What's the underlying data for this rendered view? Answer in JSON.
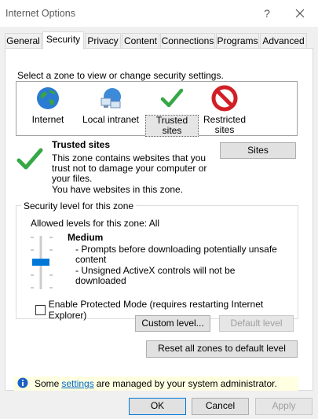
{
  "window": {
    "title": "Internet Options"
  },
  "title_buttons": {
    "help": "?",
    "close": "✕"
  },
  "tabs": [
    {
      "label": "General",
      "active": false
    },
    {
      "label": "Security",
      "active": true
    },
    {
      "label": "Privacy",
      "active": false
    },
    {
      "label": "Content",
      "active": false
    },
    {
      "label": "Connections",
      "active": false
    },
    {
      "label": "Programs",
      "active": false
    },
    {
      "label": "Advanced",
      "active": false
    }
  ],
  "security": {
    "intro": "Select a zone to view or change security settings.",
    "zones": [
      {
        "label": "Internet",
        "icon": "globe-icon"
      },
      {
        "label": "Local intranet",
        "icon": "intranet-icon"
      },
      {
        "label": "Trusted sites",
        "icon": "checkmark-icon",
        "selected": true
      },
      {
        "label": "Restricted sites",
        "icon": "restricted-icon"
      }
    ],
    "zone_info": {
      "title": "Trusted sites",
      "desc": "This zone contains websites that you trust not to damage your computer or your files.",
      "note": "You have websites in this zone.",
      "sites_button": "Sites"
    },
    "level_group": {
      "legend": "Security level for this zone",
      "allowed": "Allowed levels for this zone: All",
      "level": "Medium",
      "bullets": [
        "- Prompts before downloading potentially unsafe content",
        "- Unsigned ActiveX controls will not be downloaded"
      ],
      "protected_label": "Enable Protected Mode (requires restarting Internet Explorer)"
    },
    "custom_level_button": "Custom level...",
    "default_level_button": "Default level",
    "reset_button": "Reset all zones to default level",
    "info_bar": {
      "prefix": "Some",
      "link": "settings",
      "suffix": "are managed by your system administrator."
    }
  },
  "footer": {
    "ok": "OK",
    "cancel": "Cancel",
    "apply": "Apply"
  },
  "colors": {
    "accent": "#0078d7",
    "info_bg": "#ffffe1",
    "link": "#0066cc"
  }
}
